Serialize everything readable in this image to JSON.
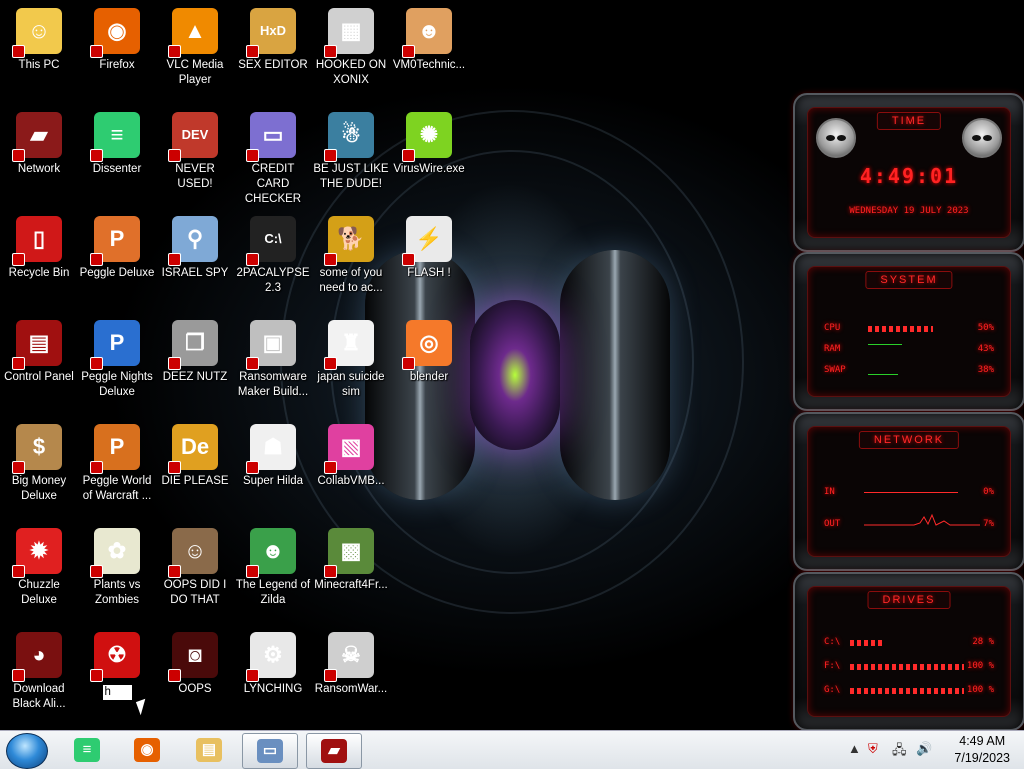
{
  "desktop": {
    "icons": [
      {
        "label": "This PC",
        "name": "this-pc",
        "bg": "#f2c94c",
        "glyph": "☺",
        "col": 0,
        "row": 0
      },
      {
        "label": "Firefox",
        "name": "firefox",
        "bg": "#e66000",
        "glyph": "◉",
        "col": 1,
        "row": 0
      },
      {
        "label": "VLC Media Player",
        "name": "vlc",
        "bg": "#f08a00",
        "glyph": "▲",
        "col": 2,
        "row": 0
      },
      {
        "label": "SEX EDITOR",
        "name": "sex-editor",
        "bg": "#d9a441",
        "glyph": "HxD",
        "col": 3,
        "row": 0
      },
      {
        "label": "HOOKED ON XONIX",
        "name": "hooked-on-xonix",
        "bg": "#d0d0d0",
        "glyph": "▦",
        "col": 4,
        "row": 0
      },
      {
        "label": "VM0Technic...",
        "name": "vm0technic",
        "bg": "#e0a060",
        "glyph": "☻",
        "col": 5,
        "row": 0
      },
      {
        "label": "Network",
        "name": "network",
        "bg": "#8b1a1a",
        "glyph": "▰",
        "col": 0,
        "row": 1
      },
      {
        "label": "Dissenter",
        "name": "dissenter",
        "bg": "#2ecc71",
        "glyph": "≡",
        "col": 1,
        "row": 1
      },
      {
        "label": "NEVER USED!",
        "name": "never-used",
        "bg": "#c0392b",
        "glyph": "DEV",
        "col": 2,
        "row": 1
      },
      {
        "label": "CREDIT CARD CHECKER",
        "name": "credit-card-checker",
        "bg": "#7d6fd1",
        "glyph": "▭",
        "col": 3,
        "row": 1
      },
      {
        "label": "BE JUST LIKE THE DUDE!",
        "name": "be-just-like-the-dude",
        "bg": "#3b7fa0",
        "glyph": "☃",
        "col": 4,
        "row": 1
      },
      {
        "label": "VirusWire.exe",
        "name": "viruswire",
        "bg": "#7ed321",
        "glyph": "✺",
        "col": 5,
        "row": 1
      },
      {
        "label": "Recycle Bin",
        "name": "recycle-bin",
        "bg": "#d01818",
        "glyph": "▯",
        "col": 0,
        "row": 2
      },
      {
        "label": "Peggle Deluxe",
        "name": "peggle-deluxe",
        "bg": "#e0702a",
        "glyph": "P",
        "col": 1,
        "row": 2
      },
      {
        "label": "ISRAEL SPY",
        "name": "israel-spy",
        "bg": "#7fa9d6",
        "glyph": "⚲",
        "col": 2,
        "row": 2
      },
      {
        "label": "2PACALYPSE 2.3",
        "name": "2pacalypse",
        "bg": "#222222",
        "glyph": "C:\\",
        "col": 3,
        "row": 2
      },
      {
        "label": "some of you need to ac...",
        "name": "some-of-you",
        "bg": "#d4a017",
        "glyph": "🐕",
        "col": 4,
        "row": 2
      },
      {
        "label": "FLASH !",
        "name": "flash",
        "bg": "#eaeaea",
        "glyph": "⚡",
        "col": 5,
        "row": 2
      },
      {
        "label": "Control Panel",
        "name": "control-panel",
        "bg": "#a01010",
        "glyph": "▤",
        "col": 0,
        "row": 3
      },
      {
        "label": "Peggle Nights Deluxe",
        "name": "peggle-nights-deluxe",
        "bg": "#2a6fd0",
        "glyph": "P",
        "col": 1,
        "row": 3
      },
      {
        "label": "DEEZ NUTZ",
        "name": "deez-nutz",
        "bg": "#9a9a9a",
        "glyph": "❐",
        "col": 2,
        "row": 3
      },
      {
        "label": "Ransomware Maker Build...",
        "name": "ransomware-maker",
        "bg": "#bfbfbf",
        "glyph": "▣",
        "col": 3,
        "row": 3
      },
      {
        "label": "japan suicide sim",
        "name": "japan-suicide-sim",
        "bg": "#f2f2f2",
        "glyph": "♜",
        "col": 4,
        "row": 3
      },
      {
        "label": "blender",
        "name": "blender",
        "bg": "#f5792a",
        "glyph": "◎",
        "col": 5,
        "row": 3
      },
      {
        "label": "Big Money Deluxe",
        "name": "big-money-deluxe",
        "bg": "#b5884c",
        "glyph": "$",
        "col": 0,
        "row": 4
      },
      {
        "label": "Peggle World of Warcraft ...",
        "name": "peggle-wow",
        "bg": "#d8701e",
        "glyph": "P",
        "col": 1,
        "row": 4
      },
      {
        "label": "DIE PLEASE",
        "name": "die-please",
        "bg": "#e0a020",
        "glyph": "De",
        "col": 2,
        "row": 4
      },
      {
        "label": "Super Hilda",
        "name": "super-hilda",
        "bg": "#f0f0f0",
        "glyph": "☗",
        "col": 3,
        "row": 4
      },
      {
        "label": "CollabVMB...",
        "name": "collabvmb",
        "bg": "#e040a0",
        "glyph": "▧",
        "col": 4,
        "row": 4
      },
      {
        "label": "Chuzzle Deluxe",
        "name": "chuzzle-deluxe",
        "bg": "#e02020",
        "glyph": "✹",
        "col": 0,
        "row": 5
      },
      {
        "label": "Plants vs Zombies",
        "name": "plants-vs-zombies",
        "bg": "#e8e8d0",
        "glyph": "✿",
        "col": 1,
        "row": 5
      },
      {
        "label": "OOPS DID I DO THAT",
        "name": "oops-did-i-do-that",
        "bg": "#8a6a4a",
        "glyph": "☺",
        "col": 2,
        "row": 5
      },
      {
        "label": "The Legend of Zilda",
        "name": "legend-of-zilda",
        "bg": "#3aa04a",
        "glyph": "☻",
        "col": 3,
        "row": 5
      },
      {
        "label": "Minecraft4Fr...",
        "name": "minecraft4fr",
        "bg": "#5a8a3a",
        "glyph": "▩",
        "col": 4,
        "row": 5
      },
      {
        "label": "Download Black Ali...",
        "name": "download-black-ali",
        "bg": "#7a1010",
        "glyph": "◕",
        "col": 0,
        "row": 6
      },
      {
        "label": "h",
        "name": "rename-item",
        "bg": "#d01010",
        "glyph": "☢",
        "col": 1,
        "row": 6,
        "editing": true
      },
      {
        "label": "OOPS",
        "name": "oops",
        "bg": "#4a0a0a",
        "glyph": "◙",
        "col": 2,
        "row": 6
      },
      {
        "label": "LYNCHING",
        "name": "lynching",
        "bg": "#e8e8e8",
        "glyph": "⚙",
        "col": 3,
        "row": 6
      },
      {
        "label": "RansomWar...",
        "name": "ransomwar",
        "bg": "#cfcfcf",
        "glyph": "☠",
        "col": 4,
        "row": 6
      }
    ]
  },
  "widgets": {
    "time": {
      "title": "TIME",
      "clock": "4:49:01",
      "date": "WEDNESDAY 19 JULY 2023"
    },
    "system": {
      "title": "SYSTEM",
      "rows": [
        {
          "label": "CPU",
          "value": "50%",
          "fraction": 0.5
        },
        {
          "label": "RAM",
          "value": "43%",
          "fraction": 0.43
        },
        {
          "label": "SWAP",
          "value": "38%",
          "fraction": 0.38
        }
      ]
    },
    "network": {
      "title": "NETWORK",
      "rows": [
        {
          "label": "IN",
          "value": "0%"
        },
        {
          "label": "OUT",
          "value": "7%"
        }
      ]
    },
    "drives": {
      "title": "DRIVES",
      "rows": [
        {
          "label": "C:\\",
          "value": "28 %",
          "fraction": 0.28
        },
        {
          "label": "F:\\",
          "value": "100 %",
          "fraction": 1.0
        },
        {
          "label": "G:\\",
          "value": "100 %",
          "fraction": 1.0
        }
      ]
    }
  },
  "taskbar": {
    "apps": [
      {
        "name": "dissenter",
        "bg": "#2ecc71",
        "glyph": "≡"
      },
      {
        "name": "firefox",
        "bg": "#e66000",
        "glyph": "◉"
      },
      {
        "name": "file-explorer",
        "bg": "#e8c060",
        "glyph": "▤"
      },
      {
        "name": "vm-window",
        "bg": "#6a8fc0",
        "glyph": "▭",
        "active": true
      },
      {
        "name": "red-app",
        "bg": "#a01010",
        "glyph": "▰",
        "active": true
      }
    ],
    "clock": {
      "time": "4:49 AM",
      "date": "7/19/2023"
    }
  },
  "colors": {
    "accent": "#ff2222"
  }
}
